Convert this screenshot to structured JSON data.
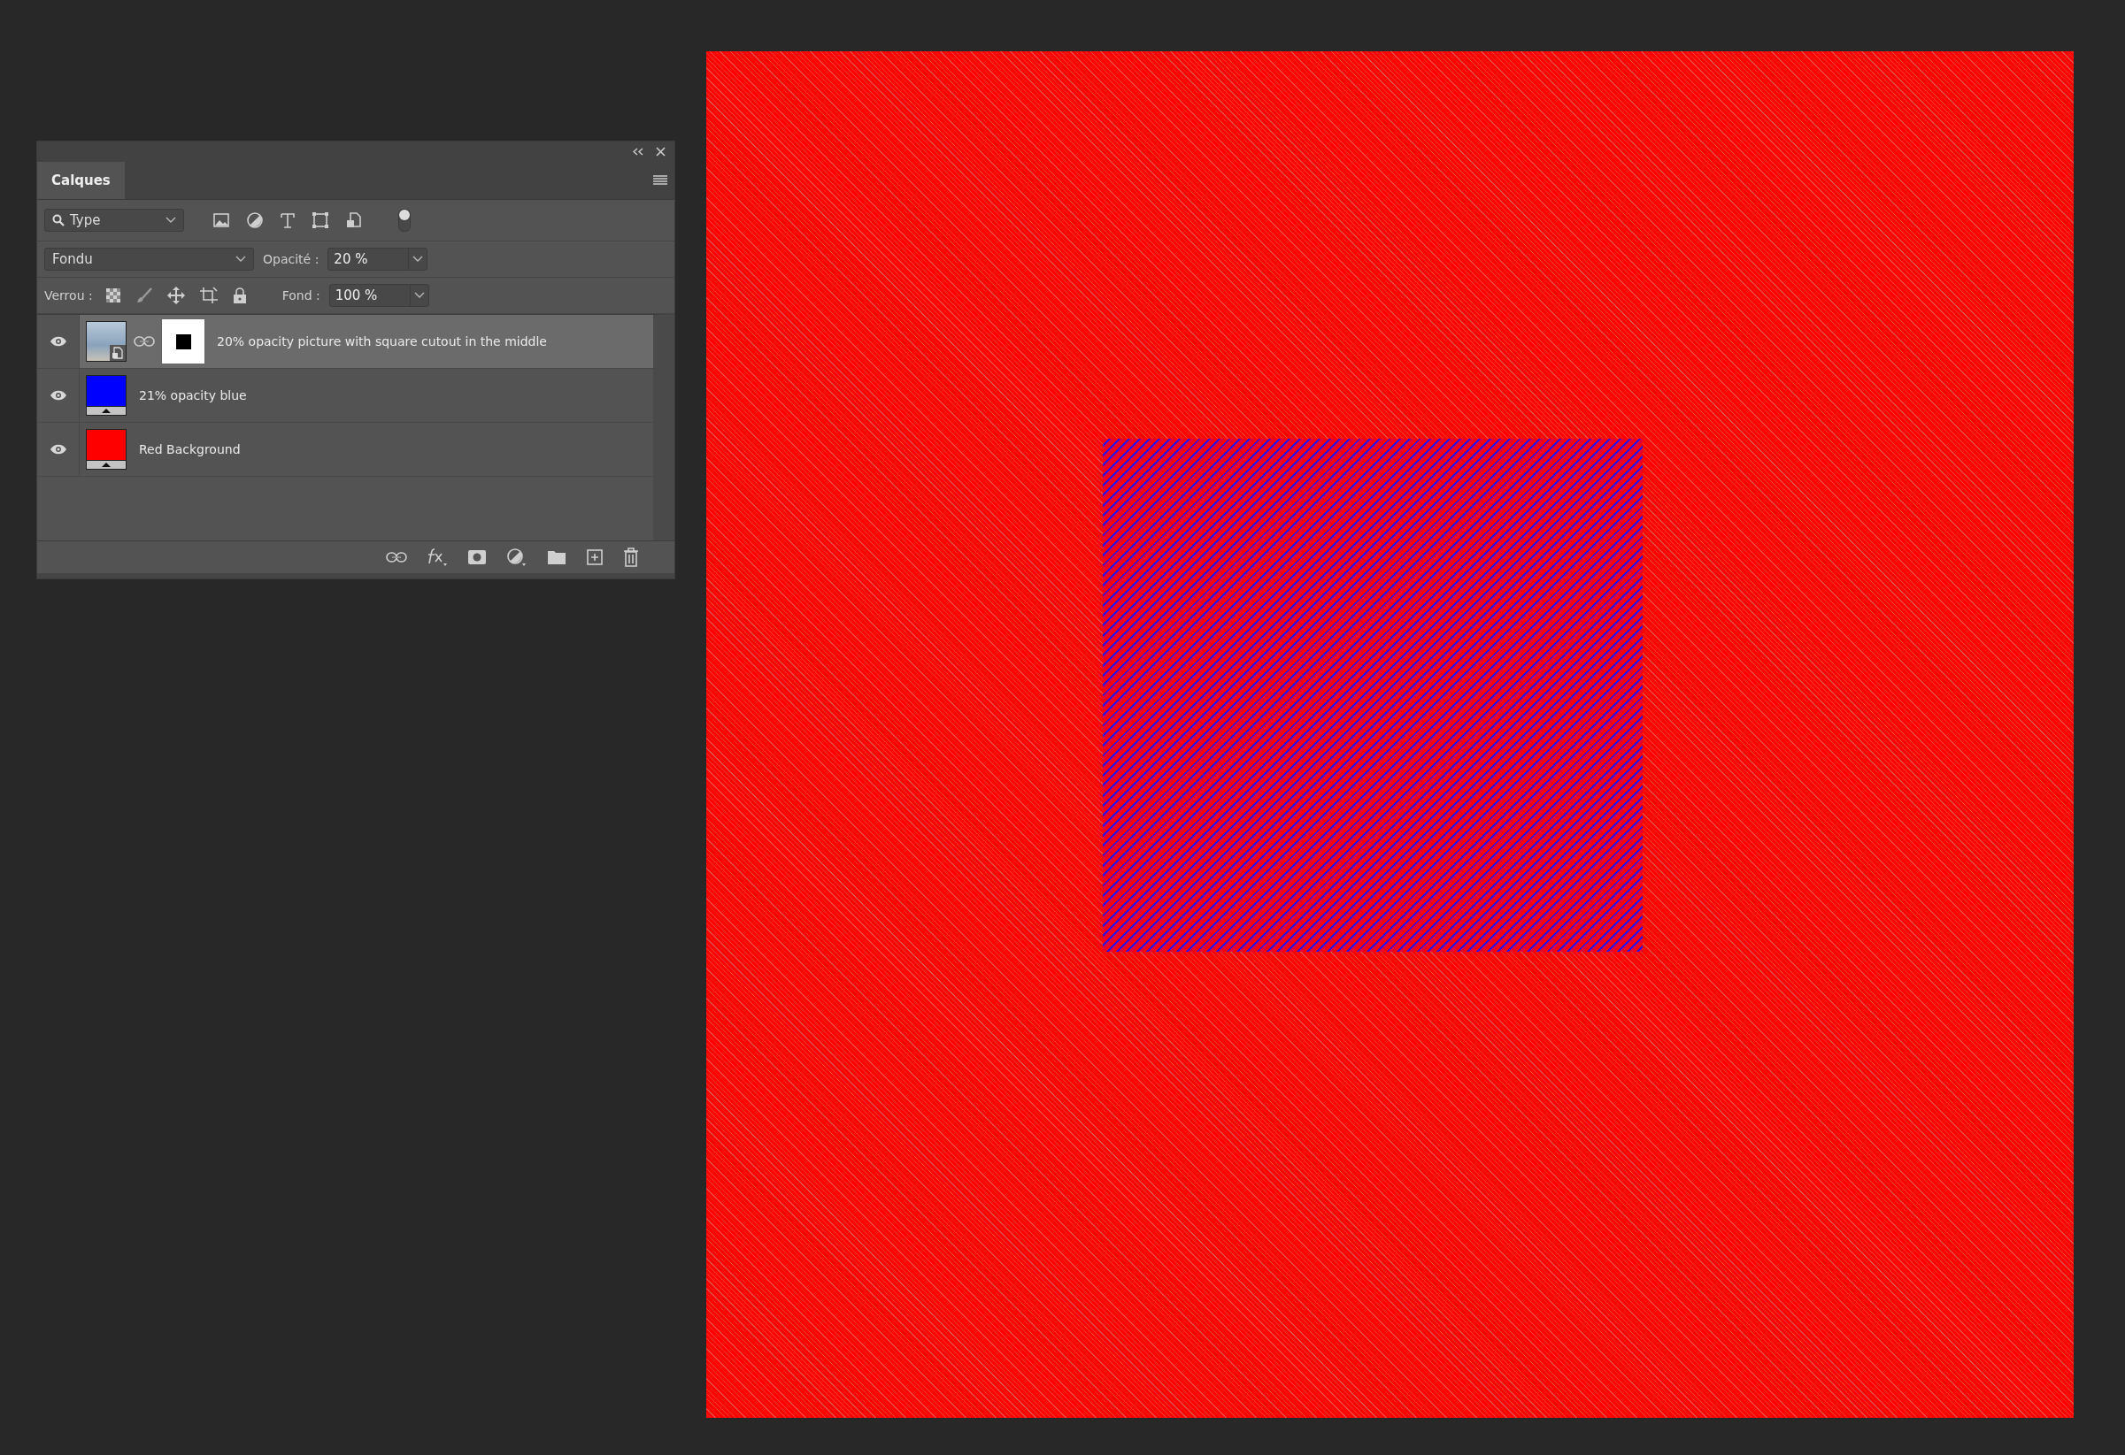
{
  "panel": {
    "tab": {
      "label": "Calques",
      "selected": true
    },
    "filter": {
      "value": "Type",
      "switch_on": true
    },
    "blend_mode": {
      "value": "Fondu"
    },
    "opacity": {
      "label": "Opacité :",
      "value": "20 %"
    },
    "lock": {
      "label": "Verrou :"
    },
    "fill": {
      "label": "Fond :",
      "value": "100 %"
    },
    "layers": [
      {
        "name": "20% opacity picture with square cutout in the middle",
        "kind": "smart-object",
        "visible": true,
        "selected": true,
        "mask": true
      },
      {
        "name": "21% opacity blue",
        "kind": "fill",
        "color": "#0000ff",
        "visible": true,
        "selected": false,
        "mask": false
      },
      {
        "name": "Red Background",
        "kind": "fill",
        "color": "#ff0000",
        "visible": true,
        "selected": false,
        "mask": false
      }
    ]
  }
}
